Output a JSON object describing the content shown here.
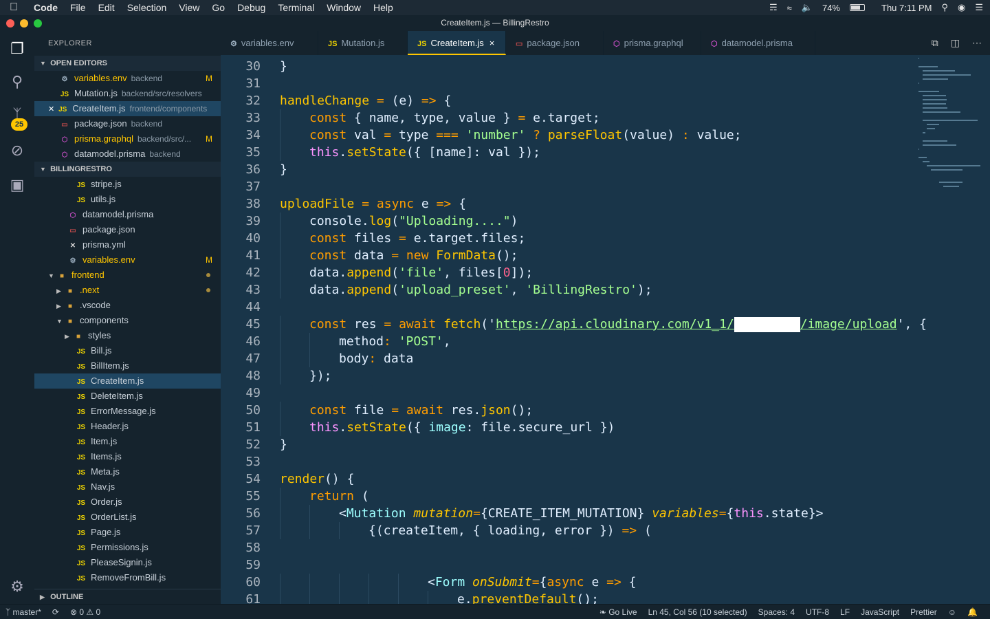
{
  "menubar": {
    "items": [
      "Code",
      "File",
      "Edit",
      "Selection",
      "View",
      "Go",
      "Debug",
      "Terminal",
      "Window",
      "Help"
    ],
    "battery": "74%",
    "clock": "Thu 7:11 PM"
  },
  "window": {
    "title": "CreateItem.js — BillingRestro"
  },
  "activity": {
    "scm_badge": "25"
  },
  "sidebar": {
    "title": "EXPLORER",
    "open_editors_label": "OPEN EDITORS",
    "open_editors": [
      {
        "icon": "⚙",
        "name": "variables.env",
        "desc": "backend",
        "mod": "M",
        "kind": "env",
        "yellow": true
      },
      {
        "icon": "JS",
        "name": "Mutation.js",
        "desc": "backend/src/resolvers",
        "mod": "",
        "kind": "js"
      },
      {
        "icon": "JS",
        "name": "CreateItem.js",
        "desc": "frontend/components",
        "mod": "",
        "kind": "js",
        "active": true
      },
      {
        "icon": "▭",
        "name": "package.json",
        "desc": "backend",
        "mod": "",
        "kind": "pkg"
      },
      {
        "icon": "⬡",
        "name": "prisma.graphql",
        "desc": "backend/src/...",
        "mod": "M",
        "kind": "prisma",
        "yellow": true
      },
      {
        "icon": "⬡",
        "name": "datamodel.prisma",
        "desc": "backend",
        "mod": "",
        "kind": "prisma"
      }
    ],
    "project_label": "BILLINGRESTRO",
    "tree": [
      {
        "indent": 60,
        "icon": "JS",
        "name": "stripe.js",
        "kind": "js"
      },
      {
        "indent": 60,
        "icon": "JS",
        "name": "utils.js",
        "kind": "js"
      },
      {
        "indent": 48,
        "icon": "⬡",
        "name": "datamodel.prisma",
        "kind": "prisma"
      },
      {
        "indent": 48,
        "icon": "▭",
        "name": "package.json",
        "kind": "pkg"
      },
      {
        "indent": 48,
        "icon": "✕",
        "name": "prisma.yml",
        "kind": "yml"
      },
      {
        "indent": 48,
        "icon": "⚙",
        "name": "variables.env",
        "kind": "env",
        "mod": "M",
        "yellow": true
      },
      {
        "indent": 20,
        "caret": "▼",
        "icon": "■",
        "name": "frontend",
        "kind": "folder",
        "dot": true,
        "yellow": true
      },
      {
        "indent": 32,
        "caret": "▶",
        "icon": "■",
        "name": ".next",
        "kind": "folder",
        "dot": true,
        "yellow": true
      },
      {
        "indent": 32,
        "caret": "▶",
        "icon": "■",
        "name": ".vscode",
        "kind": "folder"
      },
      {
        "indent": 32,
        "caret": "▼",
        "icon": "■",
        "name": "components",
        "kind": "folder"
      },
      {
        "indent": 44,
        "caret": "▶",
        "icon": "■",
        "name": "styles",
        "kind": "folder"
      },
      {
        "indent": 60,
        "icon": "JS",
        "name": "Bill.js",
        "kind": "js"
      },
      {
        "indent": 60,
        "icon": "JS",
        "name": "BillItem.js",
        "kind": "js"
      },
      {
        "indent": 60,
        "icon": "JS",
        "name": "CreateItem.js",
        "kind": "js",
        "selected": true
      },
      {
        "indent": 60,
        "icon": "JS",
        "name": "DeleteItem.js",
        "kind": "js"
      },
      {
        "indent": 60,
        "icon": "JS",
        "name": "ErrorMessage.js",
        "kind": "js"
      },
      {
        "indent": 60,
        "icon": "JS",
        "name": "Header.js",
        "kind": "js"
      },
      {
        "indent": 60,
        "icon": "JS",
        "name": "Item.js",
        "kind": "js"
      },
      {
        "indent": 60,
        "icon": "JS",
        "name": "Items.js",
        "kind": "js"
      },
      {
        "indent": 60,
        "icon": "JS",
        "name": "Meta.js",
        "kind": "js"
      },
      {
        "indent": 60,
        "icon": "JS",
        "name": "Nav.js",
        "kind": "js"
      },
      {
        "indent": 60,
        "icon": "JS",
        "name": "Order.js",
        "kind": "js"
      },
      {
        "indent": 60,
        "icon": "JS",
        "name": "OrderList.js",
        "kind": "js"
      },
      {
        "indent": 60,
        "icon": "JS",
        "name": "Page.js",
        "kind": "js"
      },
      {
        "indent": 60,
        "icon": "JS",
        "name": "Permissions.js",
        "kind": "js"
      },
      {
        "indent": 60,
        "icon": "JS",
        "name": "PleaseSignin.js",
        "kind": "js"
      },
      {
        "indent": 60,
        "icon": "JS",
        "name": "RemoveFromBill.js",
        "kind": "js"
      }
    ],
    "outline_label": "OUTLINE"
  },
  "tabs": [
    {
      "icon": "⚙",
      "label": "variables.env",
      "kind": "env"
    },
    {
      "icon": "JS",
      "label": "Mutation.js",
      "kind": "js"
    },
    {
      "icon": "JS",
      "label": "CreateItem.js",
      "kind": "js",
      "active": true,
      "close": "×"
    },
    {
      "icon": "▭",
      "label": "package.json",
      "kind": "pkg"
    },
    {
      "icon": "⬡",
      "label": "prisma.graphql",
      "kind": "prisma"
    },
    {
      "icon": "⬡",
      "label": "datamodel.prisma",
      "kind": "prisma"
    }
  ],
  "editor": {
    "lines": [
      {
        "n": "30",
        "g": 0,
        "t": [
          [
            "}",
            "pu"
          ]
        ]
      },
      {
        "n": "31",
        "g": 0,
        "t": []
      },
      {
        "n": "32",
        "g": 0,
        "t": [
          [
            "handleChange",
            "fn"
          ],
          [
            " = ",
            "op"
          ],
          [
            "(e) ",
            "pu"
          ],
          [
            "=>",
            "op"
          ],
          [
            " {",
            "pu"
          ]
        ]
      },
      {
        "n": "33",
        "g": 1,
        "t": [
          [
            "const",
            "kw"
          ],
          [
            " { name, type, value } ",
            "pu"
          ],
          [
            "=",
            "op"
          ],
          [
            " e.target;",
            "pu"
          ]
        ]
      },
      {
        "n": "34",
        "g": 1,
        "t": [
          [
            "const",
            "kw"
          ],
          [
            " val ",
            "pu"
          ],
          [
            "=",
            "op"
          ],
          [
            " type ",
            "pu"
          ],
          [
            "===",
            "op"
          ],
          [
            " ",
            "pu"
          ],
          [
            "'number'",
            "str"
          ],
          [
            " ? ",
            "op"
          ],
          [
            "parseFloat",
            "fn"
          ],
          [
            "(value) ",
            "pu"
          ],
          [
            ":",
            "op"
          ],
          [
            " value;",
            "pu"
          ]
        ]
      },
      {
        "n": "35",
        "g": 1,
        "t": [
          [
            "this",
            "this"
          ],
          [
            ".",
            "pu"
          ],
          [
            "setState",
            "fn"
          ],
          [
            "({ [name]: val });",
            "pu"
          ]
        ]
      },
      {
        "n": "36",
        "g": 0,
        "t": [
          [
            "}",
            "pu"
          ]
        ]
      },
      {
        "n": "37",
        "g": 0,
        "t": []
      },
      {
        "n": "38",
        "g": 0,
        "t": [
          [
            "uploadFile",
            "fn"
          ],
          [
            " = ",
            "op"
          ],
          [
            "async",
            "kw"
          ],
          [
            " e ",
            "pu"
          ],
          [
            "=>",
            "op"
          ],
          [
            " {",
            "pu"
          ]
        ]
      },
      {
        "n": "39",
        "g": 1,
        "t": [
          [
            "console",
            "pu"
          ],
          [
            ".",
            "pu"
          ],
          [
            "log",
            "fn"
          ],
          [
            "(",
            "pu"
          ],
          [
            "\"Uploading....\"",
            "str"
          ],
          [
            ")",
            "pu"
          ]
        ]
      },
      {
        "n": "40",
        "g": 1,
        "t": [
          [
            "const",
            "kw"
          ],
          [
            " files ",
            "pu"
          ],
          [
            "=",
            "op"
          ],
          [
            " e.target.files;",
            "pu"
          ]
        ]
      },
      {
        "n": "41",
        "g": 1,
        "t": [
          [
            "const",
            "kw"
          ],
          [
            " data ",
            "pu"
          ],
          [
            "=",
            "op"
          ],
          [
            " ",
            "pu"
          ],
          [
            "new",
            "kw"
          ],
          [
            " ",
            "pu"
          ],
          [
            "FormData",
            "fn"
          ],
          [
            "();",
            "pu"
          ]
        ]
      },
      {
        "n": "42",
        "g": 1,
        "t": [
          [
            "data.",
            "pu"
          ],
          [
            "append",
            "fn"
          ],
          [
            "(",
            "pu"
          ],
          [
            "'file'",
            "str"
          ],
          [
            ", files[",
            "pu"
          ],
          [
            "0",
            "num"
          ],
          [
            "]);",
            "pu"
          ]
        ]
      },
      {
        "n": "43",
        "g": 1,
        "t": [
          [
            "data.",
            "pu"
          ],
          [
            "append",
            "fn"
          ],
          [
            "(",
            "pu"
          ],
          [
            "'upload_preset'",
            "str"
          ],
          [
            ", ",
            "pu"
          ],
          [
            "'BillingRestro'",
            "str"
          ],
          [
            ");",
            "pu"
          ]
        ]
      },
      {
        "n": "44",
        "g": 0,
        "t": []
      },
      {
        "n": "45",
        "g": 1,
        "t": [
          [
            "const",
            "kw"
          ],
          [
            " res ",
            "pu"
          ],
          [
            "=",
            "op"
          ],
          [
            " ",
            "pu"
          ],
          [
            "await",
            "kw"
          ],
          [
            " ",
            "pu"
          ],
          [
            "fetch",
            "fn"
          ],
          [
            "('",
            "pu"
          ],
          [
            "https://api.cloudinary.com/v1_1/",
            "url"
          ],
          [
            "",
            "redact"
          ],
          [
            "/image/upload",
            "url"
          ],
          [
            "', {",
            "pu"
          ]
        ]
      },
      {
        "n": "46",
        "g": 2,
        "t": [
          [
            "method",
            "pu"
          ],
          [
            ": ",
            "op"
          ],
          [
            "'POST'",
            "str"
          ],
          [
            ",",
            "pu"
          ]
        ]
      },
      {
        "n": "47",
        "g": 2,
        "t": [
          [
            "body",
            "pu"
          ],
          [
            ": ",
            "op"
          ],
          [
            "data",
            "pu"
          ]
        ]
      },
      {
        "n": "48",
        "g": 1,
        "t": [
          [
            "});",
            "pu"
          ]
        ]
      },
      {
        "n": "49",
        "g": 0,
        "t": []
      },
      {
        "n": "50",
        "g": 1,
        "t": [
          [
            "const",
            "kw"
          ],
          [
            " file ",
            "pu"
          ],
          [
            "=",
            "op"
          ],
          [
            " ",
            "pu"
          ],
          [
            "await",
            "kw"
          ],
          [
            " res.",
            "pu"
          ],
          [
            "json",
            "fn"
          ],
          [
            "();",
            "pu"
          ]
        ]
      },
      {
        "n": "51",
        "g": 1,
        "t": [
          [
            "this",
            "this"
          ],
          [
            ".",
            "pu"
          ],
          [
            "setState",
            "fn"
          ],
          [
            "({ ",
            "pu"
          ],
          [
            "image",
            "tag"
          ],
          [
            ": file.secure_url })",
            "pu"
          ]
        ]
      },
      {
        "n": "52",
        "g": 0,
        "t": [
          [
            "}",
            "pu"
          ]
        ]
      },
      {
        "n": "53",
        "g": 0,
        "t": []
      },
      {
        "n": "54",
        "g": 0,
        "t": [
          [
            "render",
            "fn"
          ],
          [
            "() {",
            "pu"
          ]
        ]
      },
      {
        "n": "55",
        "g": 1,
        "t": [
          [
            "return",
            "kw"
          ],
          [
            " (",
            "pu"
          ]
        ]
      },
      {
        "n": "56",
        "g": 2,
        "t": [
          [
            "<",
            "pu"
          ],
          [
            "Mutation",
            "tag"
          ],
          [
            " ",
            "pu"
          ],
          [
            "mutation",
            "attr"
          ],
          [
            "=",
            "op"
          ],
          [
            "{CREATE_ITEM_MUTATION} ",
            "pu"
          ],
          [
            "variables",
            "attr"
          ],
          [
            "=",
            "op"
          ],
          [
            "{",
            "pu"
          ],
          [
            "this",
            "this"
          ],
          [
            ".state}>",
            "pu"
          ]
        ]
      },
      {
        "n": "57",
        "g": 3,
        "t": [
          [
            "{(createItem, { loading, error }) ",
            "pu"
          ],
          [
            "=>",
            "op"
          ],
          [
            " (",
            "pu"
          ]
        ]
      },
      {
        "n": "58",
        "g": 0,
        "t": []
      },
      {
        "n": "59",
        "g": 0,
        "t": []
      },
      {
        "n": "60",
        "g": 5,
        "t": [
          [
            "<",
            "pu"
          ],
          [
            "Form",
            "tag"
          ],
          [
            " ",
            "pu"
          ],
          [
            "onSubmit",
            "attr"
          ],
          [
            "=",
            "op"
          ],
          [
            "{",
            "pu"
          ],
          [
            "async",
            "kw"
          ],
          [
            " e ",
            "pu"
          ],
          [
            "=>",
            "op"
          ],
          [
            " {",
            "pu"
          ]
        ]
      },
      {
        "n": "61",
        "g": 6,
        "t": [
          [
            "e.",
            "pu"
          ],
          [
            "preventDefault",
            "fn"
          ],
          [
            "();",
            "pu"
          ]
        ]
      }
    ]
  },
  "statusbar": {
    "branch": "master*",
    "errors": "0",
    "warnings": "0",
    "golive": "Go Live",
    "position": "Ln 45, Col 56 (10 selected)",
    "spaces": "Spaces: 4",
    "encoding": "UTF-8",
    "eol": "LF",
    "language": "JavaScript",
    "formatter": "Prettier"
  }
}
